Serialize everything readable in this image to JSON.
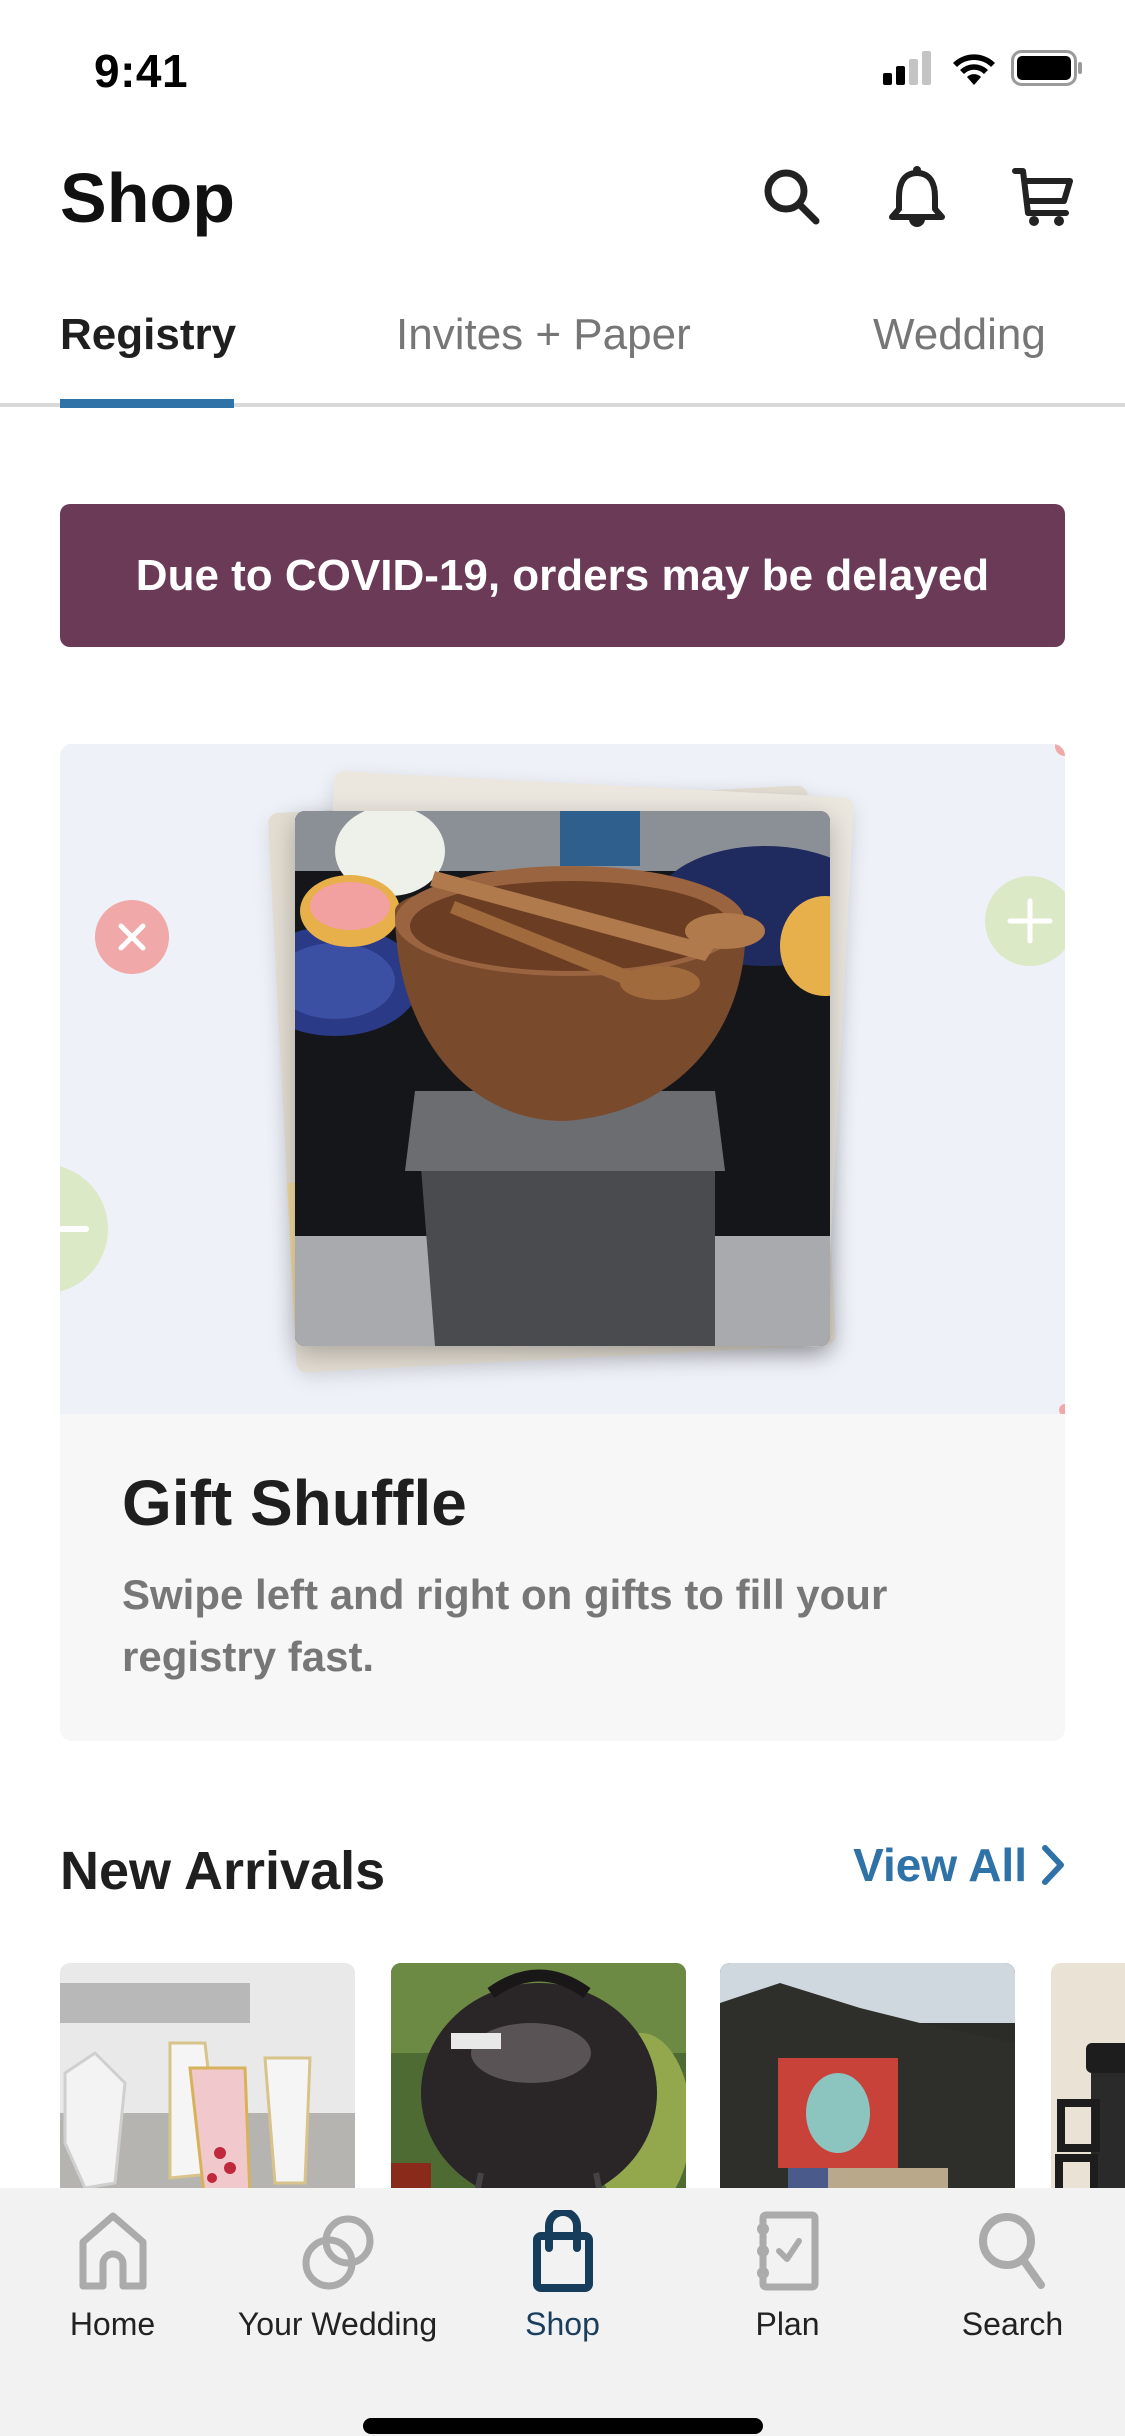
{
  "status_bar": {
    "time": "9:41",
    "icons": [
      "cellular-signal-icon",
      "wifi-icon",
      "battery-icon"
    ]
  },
  "header": {
    "title": "Shop",
    "actions": [
      {
        "name": "search",
        "icon": "search-icon"
      },
      {
        "name": "notifications",
        "icon": "bell-icon"
      },
      {
        "name": "cart",
        "icon": "cart-icon"
      }
    ]
  },
  "tabs": [
    {
      "label": "Registry",
      "active": true
    },
    {
      "label": "Invites + Paper",
      "active": false
    },
    {
      "label": "Wedding",
      "active": false
    }
  ],
  "banner": {
    "text": "Due to COVID-19, orders may be delayed",
    "color": "#6b3a56"
  },
  "gift_shuffle": {
    "title": "Gift Shuffle",
    "subtitle": "Swipe left and right on gifts to fill your registry fast.",
    "featured_image": "wooden salad bowl with servers on table runner",
    "reject_icon": "close-icon",
    "accept_icon": "plus-icon"
  },
  "new_arrivals": {
    "title": "New Arrivals",
    "view_all_label": "View All",
    "products": [
      {
        "image": "gold-rimmed stemless glasses"
      },
      {
        "image": "portable charcoal grill"
      },
      {
        "image": "picnic basket set"
      },
      {
        "image": "black insulated mugs"
      }
    ]
  },
  "tab_bar": {
    "items": [
      {
        "label": "Home",
        "icon": "home-icon",
        "active": false
      },
      {
        "label": "Your Wedding",
        "icon": "rings-icon",
        "active": false
      },
      {
        "label": "Shop",
        "icon": "shopping-bag-icon",
        "active": true
      },
      {
        "label": "Plan",
        "icon": "checklist-icon",
        "active": false
      },
      {
        "label": "Search",
        "icon": "search-icon",
        "active": false
      }
    ]
  },
  "colors": {
    "accent": "#2f72a8",
    "active_tab_bar": "#1a3f5e",
    "inactive_icon": "#ababab",
    "reject": "#f0a8a8",
    "accept": "#dbe9c6"
  }
}
